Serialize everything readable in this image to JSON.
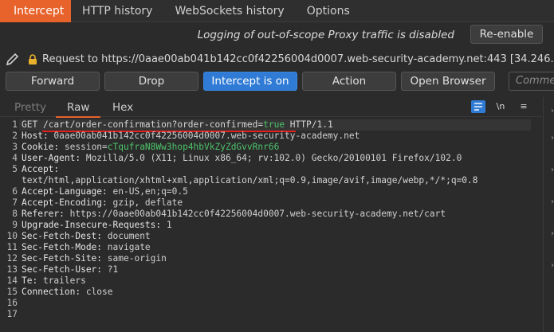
{
  "top_tabs": [
    "Intercept",
    "HTTP history",
    "WebSockets history",
    "Options"
  ],
  "logging_note": "Logging of out-of-scope Proxy traffic is disabled",
  "reenable_label": "Re-enable",
  "request_line": "Request to https://0aae00ab041b142cc0f42256004d0007.web-security-academy.net:443  [34.246.129",
  "toolbar": {
    "forward": "Forward",
    "drop": "Drop",
    "intercept": "Intercept is on",
    "action": "Action",
    "open_browser": "Open Browser",
    "comment_placeholder": "Comme"
  },
  "editor_tabs": [
    "Pretty",
    "Raw",
    "Hex"
  ],
  "editor_icons": {
    "newline": "\\n",
    "menu": "≡"
  },
  "accent": "#e8632c",
  "intercept_color": "#2f7bd6",
  "lines": {
    "l1": {
      "method": "GET ",
      "path": "/cart/order-confirmation?order-confirmed=",
      "flag": "true",
      "proto": " HTTP/1.1"
    },
    "l2": {
      "name": "Host:",
      "value": " 0aae00ab041b142cc0f42256004d0007.web-security-academy.net"
    },
    "l3": {
      "name": "Cookie:",
      "value": " session=",
      "cookie": "cTqufraN8Ww3hop4hbVkZyZdGvvRnr66"
    },
    "l4": {
      "name": "User-Agent:",
      "value": " Mozilla/5.0 (X11; Linux x86_64; rv:102.0) Gecko/20100101 Firefox/102.0"
    },
    "l5": {
      "name": "Accept:",
      "value": ""
    },
    "l5b": "text/html,application/xhtml+xml,application/xml;q=0.9,image/avif,image/webp,*/*;q=0.8",
    "l6": {
      "name": "Accept-Language:",
      "value": " en-US,en;q=0.5"
    },
    "l7": {
      "name": "Accept-Encoding:",
      "value": " gzip, deflate"
    },
    "l8": {
      "name": "Referer:",
      "value": " https://0aae00ab041b142cc0f42256004d0007.web-security-academy.net/cart"
    },
    "l9": {
      "name": "Upgrade-Insecure-Requests:",
      "value": " 1"
    },
    "l10": {
      "name": "Sec-Fetch-Dest:",
      "value": " document"
    },
    "l11": {
      "name": "Sec-Fetch-Mode:",
      "value": " navigate"
    },
    "l12": {
      "name": "Sec-Fetch-Site:",
      "value": " same-origin"
    },
    "l13": {
      "name": "Sec-Fetch-User:",
      "value": " ?1"
    },
    "l14": {
      "name": "Te:",
      "value": " trailers"
    },
    "l15": {
      "name": "Connection:",
      "value": " close"
    }
  },
  "line_numbers": [
    "1",
    "2",
    "3",
    "4",
    "5",
    "6",
    "7",
    "8",
    "9",
    "10",
    "11",
    "12",
    "13",
    "14",
    "15",
    "16",
    "17"
  ]
}
